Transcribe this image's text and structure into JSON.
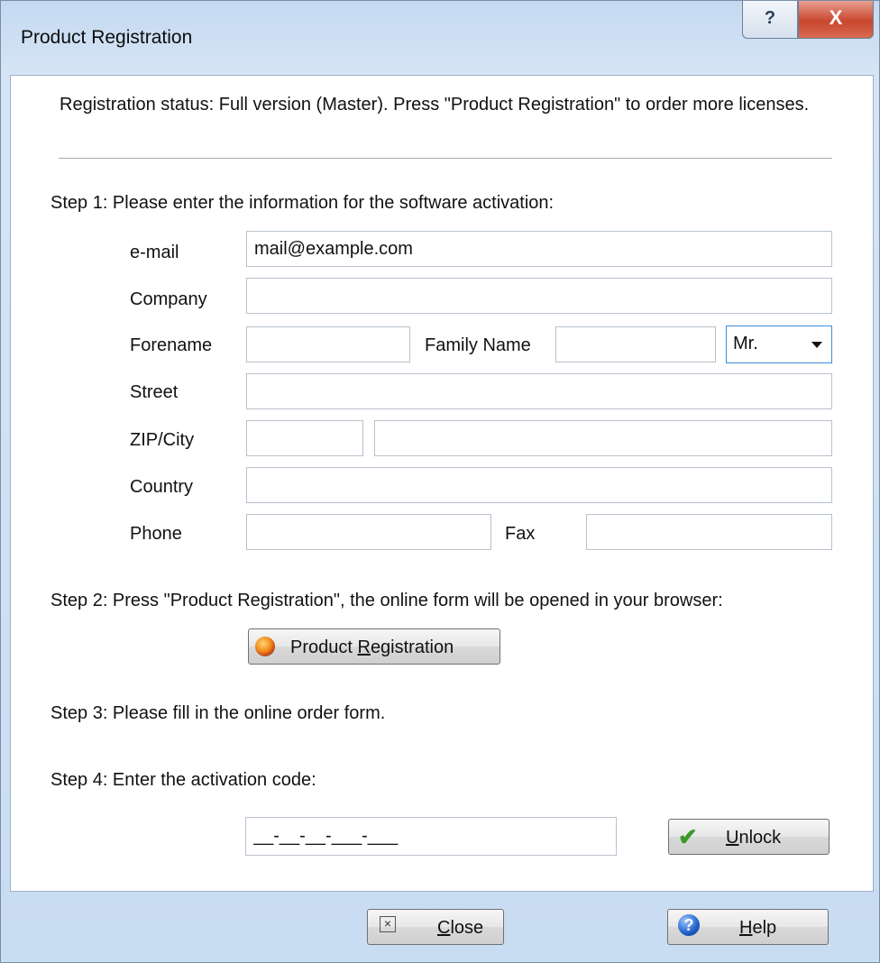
{
  "window": {
    "title": "Product Registration",
    "help_glyph": "?",
    "close_glyph": "X"
  },
  "status_text": "Registration status: Full version (Master). Press \"Product Registration\" to order more licenses.",
  "step1": {
    "heading": "Step 1: Please enter the information for the software activation:",
    "labels": {
      "email": "e-mail",
      "company": "Company",
      "forename": "Forename",
      "family_name": "Family Name",
      "street": "Street",
      "zip_city": "ZIP/City",
      "country": "Country",
      "phone": "Phone",
      "fax": "Fax"
    },
    "values": {
      "email": "mail@example.com",
      "company": "",
      "forename": "",
      "family_name": "",
      "salutation": "Mr.",
      "street": "",
      "zip": "",
      "city": "",
      "country": "",
      "phone": "",
      "fax": ""
    }
  },
  "step2": {
    "heading": "Step 2: Press \"Product Registration\", the online form will be opened in your browser:",
    "button_pre": "Product ",
    "button_accel": "R",
    "button_post": "egistration"
  },
  "step3": {
    "heading": "Step 3: Please fill in the online order form."
  },
  "step4": {
    "heading": "Step 4: Enter the activation code:",
    "code_mask": "__-__-__-___-___",
    "unlock_accel": "U",
    "unlock_post": "nlock"
  },
  "footer": {
    "close_accel": "C",
    "close_post": "lose",
    "help_accel": "H",
    "help_post": "elp"
  },
  "icons": {
    "registration": "globe-icon",
    "unlock": "checkmark-icon",
    "close": "close-icon",
    "help": "help-icon"
  }
}
